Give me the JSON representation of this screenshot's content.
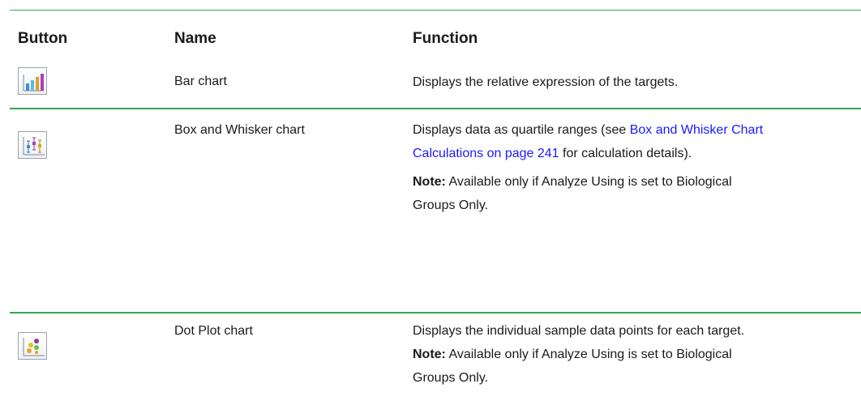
{
  "table": {
    "headers": {
      "button": "Button",
      "name": "Name",
      "function": "Function"
    },
    "rows": [
      {
        "icon": "bar-chart-icon",
        "name": "Bar chart",
        "function_text": "Displays the relative expression of the targets."
      },
      {
        "icon": "box-whisker-chart-icon",
        "name": "Box and Whisker chart",
        "function_before_link": "Displays data as quartile ranges (see ",
        "link_text": "Box and Whisker Chart Calculations on page 241",
        "function_after_link": " for calculation details).",
        "note_label": "Note:",
        "note_text": " Available only if Analyze Using is set to Biological Groups Only."
      },
      {
        "icon": "dot-plot-chart-icon",
        "name": "Dot Plot chart",
        "function_text": "Displays the individual sample data points for each target.",
        "note_label": "Note:",
        "note_text": " Available only if Analyze Using is set to Biological Groups Only."
      }
    ]
  },
  "colors": {
    "rule": "#33a852",
    "link": "#1a1aff"
  }
}
